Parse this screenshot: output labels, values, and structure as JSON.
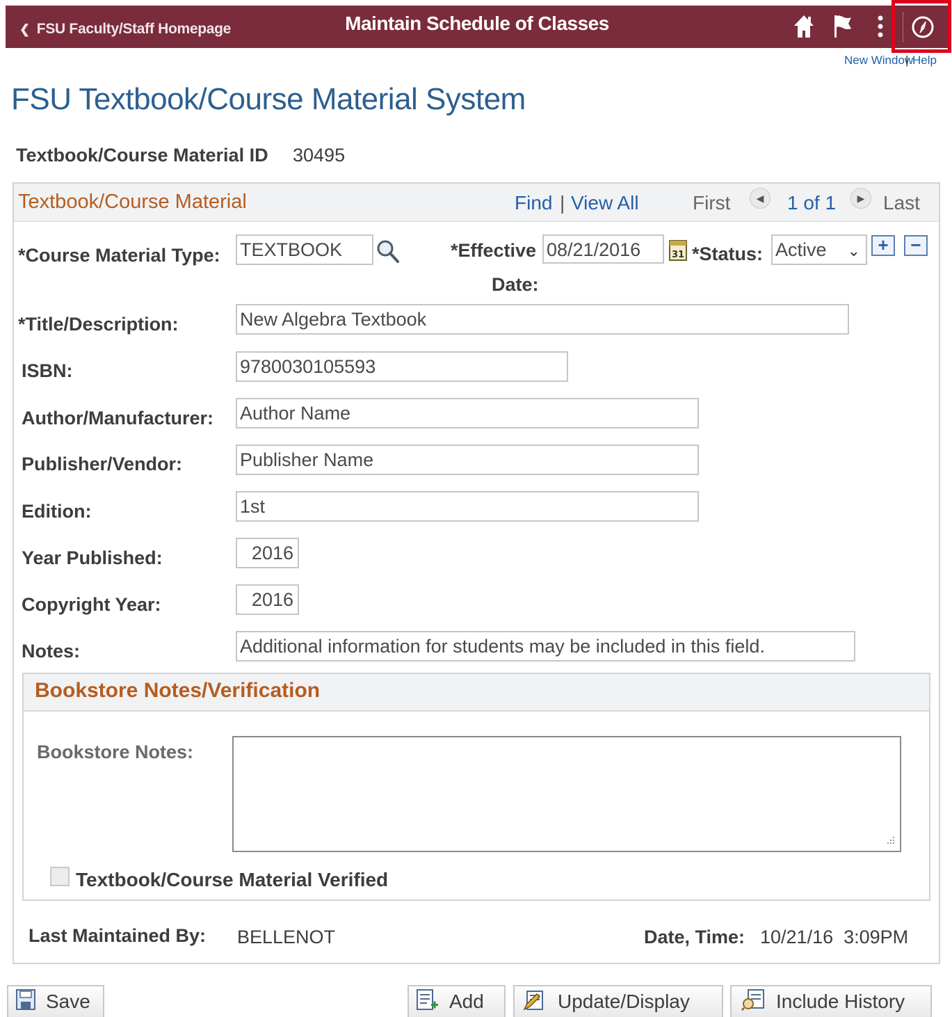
{
  "header": {
    "back_label": "FSU Faculty/Staff Homepage",
    "title": "Maintain Schedule of Classes",
    "icons": [
      "home-icon",
      "flag-icon",
      "more-vertical-icon",
      "navbar-compass-icon"
    ]
  },
  "toplinks": {
    "new_window": "New Window",
    "separator": "|",
    "help": "Help"
  },
  "page": {
    "title": "FSU Textbook/Course Material System",
    "id_label": "Textbook/Course Material ID",
    "id_value": "30495"
  },
  "panel": {
    "title": "Textbook/Course Material",
    "find": "Find",
    "separator": "|",
    "view_all": "View All",
    "first": "First",
    "count": "1 of 1",
    "last": "Last"
  },
  "form": {
    "course_material_type_label": "*Course Material Type:",
    "course_material_type_value": "TEXTBOOK",
    "effective_label": "*Effective",
    "effective_label2": "Date:",
    "effective_value": "08/21/2016",
    "calendar_text": "31",
    "status_label": "*Status:",
    "status_value": "Active",
    "add_row": "+",
    "delete_row": "−",
    "title_label": "*Title/Description:",
    "title_value": "New Algebra Textbook",
    "isbn_label": "ISBN:",
    "isbn_value": "9780030105593",
    "author_label": "Author/Manufacturer:",
    "author_value": "Author Name",
    "publisher_label": "Publisher/Vendor:",
    "publisher_value": "Publisher Name",
    "edition_label": "Edition:",
    "edition_value": "1st",
    "year_published_label": "Year Published:",
    "year_published_value": "2016",
    "copyright_label": "Copyright Year:",
    "copyright_value": "2016",
    "notes_label": "Notes:",
    "notes_value": "Additional information for students may be included in this field."
  },
  "bookstore": {
    "title": "Bookstore Notes/Verification",
    "notes_label": "Bookstore Notes:",
    "notes_value": "",
    "verified_label": "Textbook/Course Material Verified",
    "verified": false
  },
  "footer": {
    "last_maintained_label": "Last Maintained By:",
    "last_maintained_value": "BELLENOT",
    "datetime_label": "Date, Time:",
    "datetime_value": "10/21/16  3:09PM"
  },
  "buttons": {
    "save": "Save",
    "add": "Add",
    "update_display": "Update/Display",
    "include_history": "Include History"
  }
}
